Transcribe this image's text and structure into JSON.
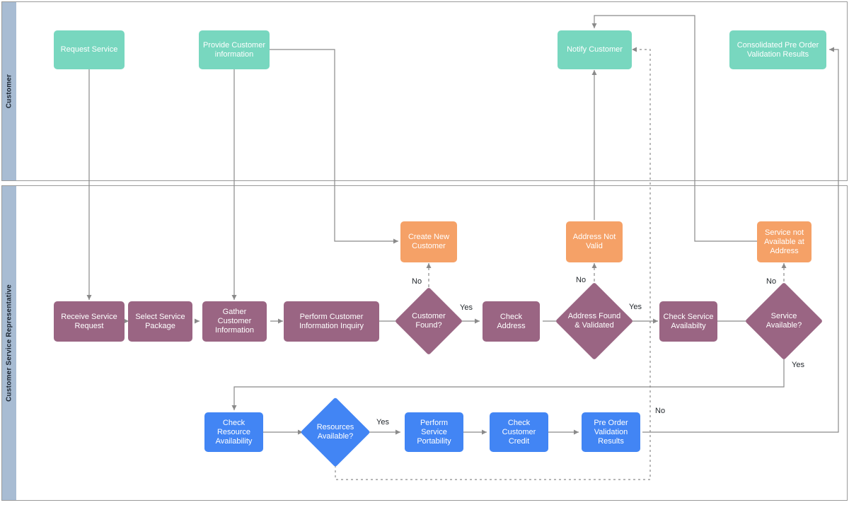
{
  "diagram": {
    "title": "Service Request Pre-Order Validation Swimlane",
    "type": "swimlane-flowchart",
    "colors": {
      "lane_header": "#a8bcd3",
      "lane_border": "#9a9a9a",
      "customer_node": "#78d7bf",
      "process_node": "#9a6583",
      "exception_node": "#f5a167",
      "system_node": "#4285f4",
      "connector": "#8a8a8a",
      "label_text": "#23282d"
    }
  },
  "lanes": [
    {
      "id": "customer",
      "label": "Customer"
    },
    {
      "id": "csr",
      "label": "Customer Service Representative"
    }
  ],
  "nodes": [
    {
      "id": "request_service",
      "label": "Request Service",
      "shape": "rect",
      "color": "green",
      "lane": "customer"
    },
    {
      "id": "provide_cust_info",
      "label": "Provide Customer information",
      "shape": "rect",
      "color": "green",
      "lane": "customer"
    },
    {
      "id": "notify_customer",
      "label": "Notify Customer",
      "shape": "rect",
      "color": "green",
      "lane": "customer"
    },
    {
      "id": "consolidated_results",
      "label": "Consolidated Pre Order Validation Results",
      "shape": "rect",
      "color": "green",
      "lane": "customer"
    },
    {
      "id": "receive_request",
      "label": "Receive Service Request",
      "shape": "rect",
      "color": "purple",
      "lane": "csr"
    },
    {
      "id": "select_package",
      "label": "Select Service Package",
      "shape": "rect",
      "color": "purple",
      "lane": "csr"
    },
    {
      "id": "gather_info",
      "label": "Gather Customer Information",
      "shape": "rect",
      "color": "purple",
      "lane": "csr"
    },
    {
      "id": "perform_inquiry",
      "label": "Perform Customer Information Inquiry",
      "shape": "rect",
      "color": "purple",
      "lane": "csr"
    },
    {
      "id": "customer_found",
      "label": "Customer Found?",
      "shape": "diamond",
      "color": "purple",
      "lane": "csr"
    },
    {
      "id": "create_new_customer",
      "label": "Create New Customer",
      "shape": "rect",
      "color": "orange",
      "lane": "csr"
    },
    {
      "id": "check_address",
      "label": "Check Address",
      "shape": "rect",
      "color": "purple",
      "lane": "csr"
    },
    {
      "id": "address_found",
      "label": "Address Found & Validated",
      "shape": "diamond",
      "color": "purple",
      "lane": "csr"
    },
    {
      "id": "address_not_valid",
      "label": "Address Not Valid",
      "shape": "rect",
      "color": "orange",
      "lane": "csr"
    },
    {
      "id": "check_service_avail",
      "label": "Check Service Availabilty",
      "shape": "rect",
      "color": "purple",
      "lane": "csr"
    },
    {
      "id": "service_available",
      "label": "Service Available?",
      "shape": "diamond",
      "color": "purple",
      "lane": "csr"
    },
    {
      "id": "service_not_avail",
      "label": "Service not Available at Address",
      "shape": "rect",
      "color": "orange",
      "lane": "csr"
    },
    {
      "id": "check_resource",
      "label": "Check Resource Availability",
      "shape": "rect",
      "color": "blue",
      "lane": "csr"
    },
    {
      "id": "resources_available",
      "label": "Resources Available?",
      "shape": "diamond",
      "color": "blue",
      "lane": "csr"
    },
    {
      "id": "perform_portability",
      "label": "Perform Service Portability",
      "shape": "rect",
      "color": "blue",
      "lane": "csr"
    },
    {
      "id": "check_credit",
      "label": "Check Customer Credit",
      "shape": "rect",
      "color": "blue",
      "lane": "csr"
    },
    {
      "id": "pre_order_results",
      "label": "Pre Order Validation Results",
      "shape": "rect",
      "color": "blue",
      "lane": "csr"
    }
  ],
  "edge_labels": [
    {
      "id": "lbl_cf_no",
      "text": "No"
    },
    {
      "id": "lbl_cf_yes",
      "text": "Yes"
    },
    {
      "id": "lbl_af_no",
      "text": "No"
    },
    {
      "id": "lbl_af_yes",
      "text": "Yes"
    },
    {
      "id": "lbl_sa_no",
      "text": "No"
    },
    {
      "id": "lbl_sa_yes",
      "text": "Yes"
    },
    {
      "id": "lbl_ra_yes",
      "text": "Yes"
    },
    {
      "id": "lbl_ra_no",
      "text": "No"
    }
  ]
}
